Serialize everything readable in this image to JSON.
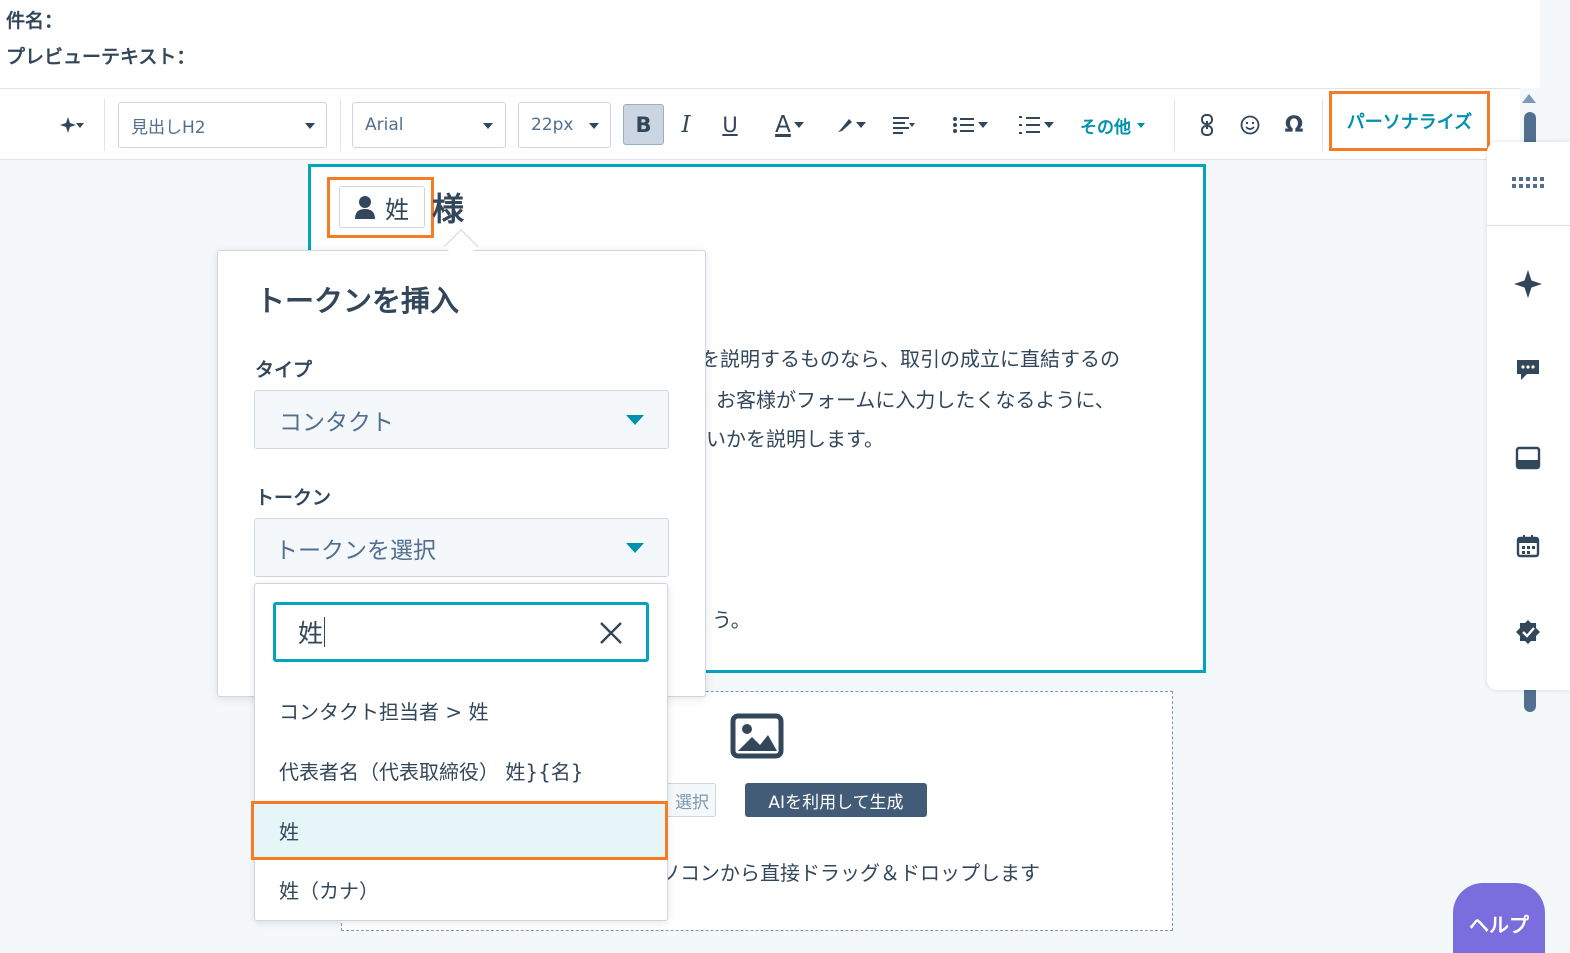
{
  "meta": {
    "subject_label": "件名：",
    "preview_label": "プレビューテキスト："
  },
  "toolbar": {
    "heading_select": "見出しH2",
    "font_select": "Arial",
    "size_select": "22px",
    "bold": "B",
    "italic": "I",
    "underline": "U",
    "font_color": "A",
    "more": "その他",
    "personalize": "パーソナライズ"
  },
  "email": {
    "token_chip": "姓",
    "greeting_suffix": "様",
    "line1": "を説明するものなら、取引の成立に直結するの",
    "line2": "お客様がフォームに入力したくなるように、",
    "line3": "いかを説明します。",
    "line4": "う。"
  },
  "image_block": {
    "select_button": "選択",
    "ai_button": "AIを利用して生成",
    "drop_hint": "ソコンから直接ドラッグ＆ドロップします"
  },
  "popover": {
    "title": "トークンを挿入",
    "type_label": "タイプ",
    "type_value": "コンタクト",
    "token_label": "トークン",
    "token_placeholder": "トークンを選択",
    "search_value": "姓",
    "items": [
      "コンタクト担当者 > 姓",
      "代表者名（代表取締役） 姓}{名}",
      "姓",
      "姓（カナ）"
    ]
  },
  "help": {
    "label": "ヘルプ"
  },
  "colors": {
    "accent": "#00a4bd",
    "link": "#0091ae",
    "highlight": "#f57c24",
    "text": "#33475b",
    "help": "#7a6dde"
  }
}
